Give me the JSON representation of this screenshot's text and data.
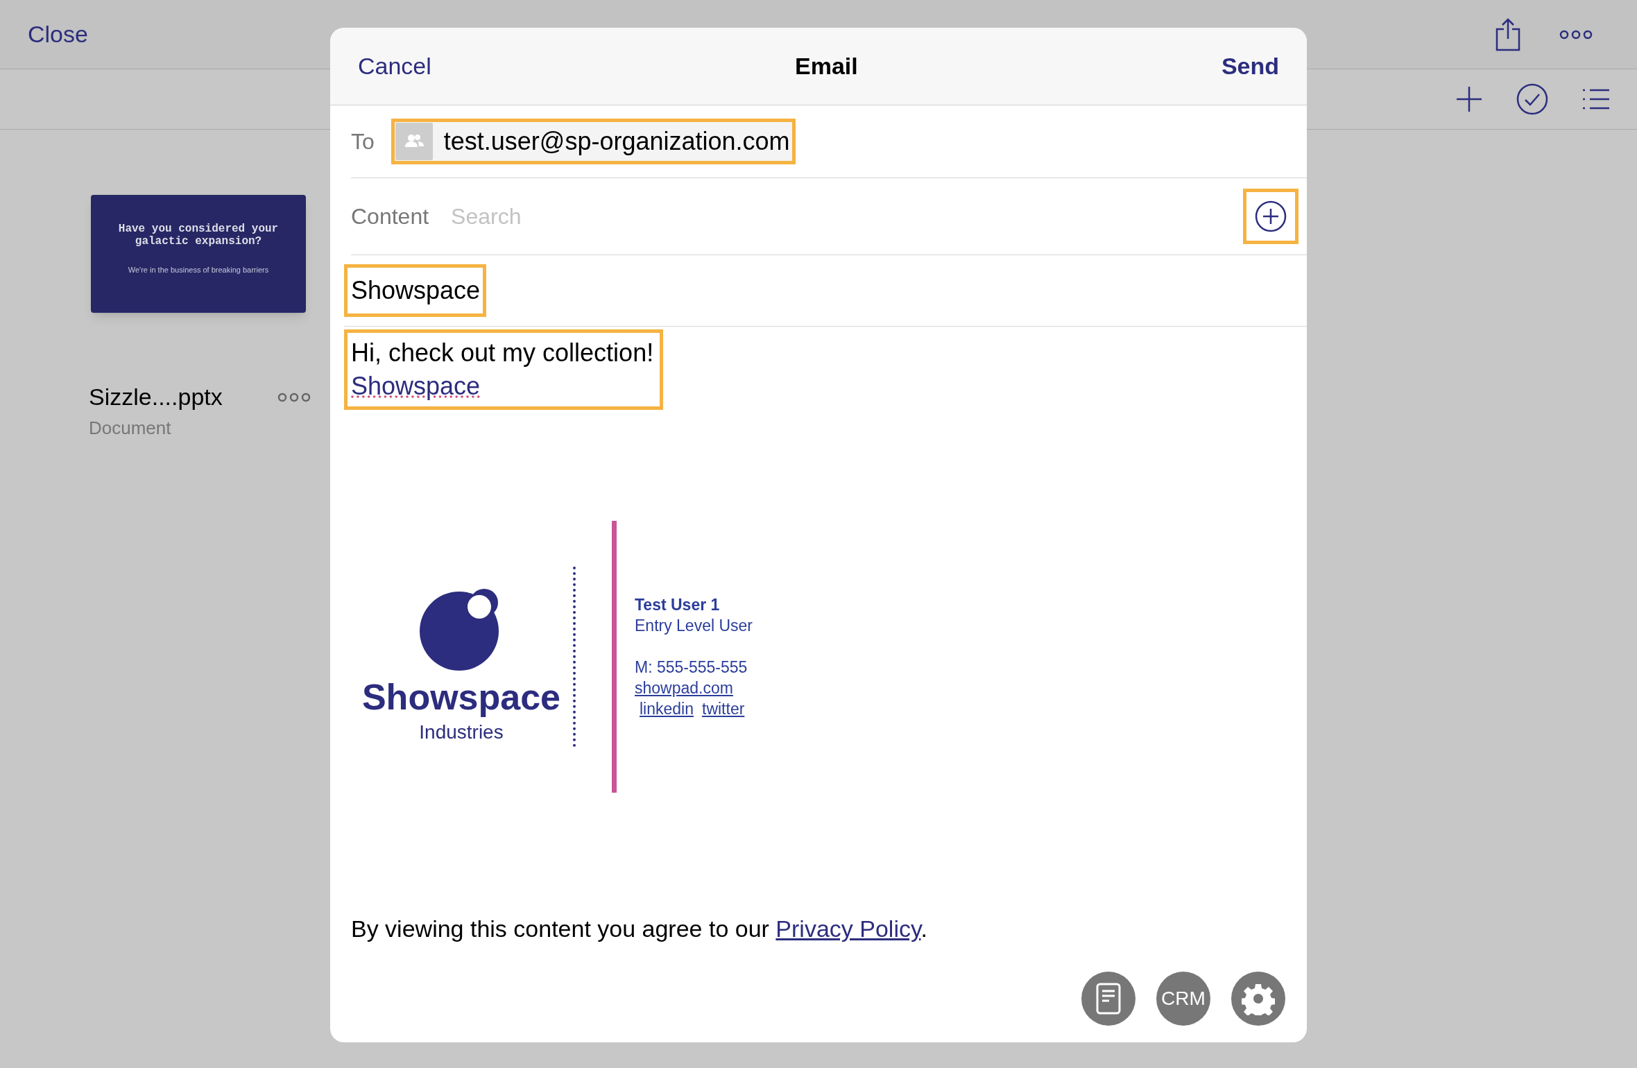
{
  "background": {
    "close_button": "Close",
    "document": {
      "thumbnail": {
        "headline": "Have you considered your galactic expansion?",
        "tagline": "We're in the business of breaking barriers"
      },
      "name": "Sizzle....pptx",
      "type_label": "Document"
    }
  },
  "email": {
    "title": "Email",
    "cancel": "Cancel",
    "send": "Send",
    "to": {
      "label": "To",
      "recipient": "test.user@sp-organization.com",
      "highlighted": true
    },
    "content": {
      "label": "Content",
      "placeholder": "Search",
      "add_highlighted": true
    },
    "subject": {
      "value": "Showspace",
      "highlighted": true
    },
    "body": {
      "text": "Hi, check out my collection!",
      "link": "Showspace",
      "highlighted": true
    },
    "signature": {
      "logo_name": "Showspace",
      "logo_sub": "Industries",
      "name": "Test User 1",
      "role": "Entry Level User",
      "phone": "M: 555-555-555",
      "website": "showpad.com",
      "links": [
        "linkedin",
        "twitter"
      ]
    },
    "footer": {
      "text_before": "By viewing this content you agree to our ",
      "link": "Privacy Policy",
      "text_after": "."
    },
    "actions": [
      {
        "kind": "document"
      },
      {
        "kind": "text",
        "label": "CRM"
      },
      {
        "kind": "settings"
      }
    ]
  }
}
